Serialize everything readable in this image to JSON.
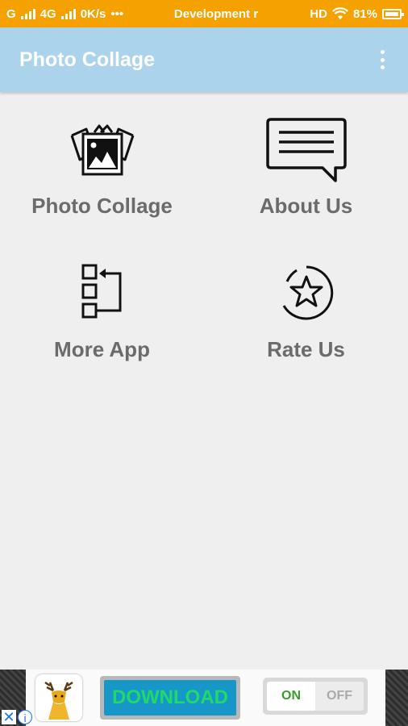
{
  "status_bar": {
    "carrier_signal": "G",
    "network": "4G",
    "speed": "0K/s",
    "more": "•••",
    "notification": "Development r",
    "hd": "HD",
    "battery": "81%"
  },
  "app_bar": {
    "title": "Photo Collage",
    "menu_icon": "overflow-menu-icon"
  },
  "menu": [
    {
      "label": "Photo Collage",
      "icon": "photo-collage-icon"
    },
    {
      "label": "About Us",
      "icon": "chat-bubble-icon"
    },
    {
      "label": "More App",
      "icon": "more-apps-icon"
    },
    {
      "label": "Rate Us",
      "icon": "star-icon"
    }
  ],
  "ad": {
    "download_label": "DOWNLOAD",
    "toggle_on": "ON",
    "toggle_off": "OFF",
    "close_glyph": "✕",
    "info_glyph": "i"
  },
  "colors": {
    "status_bar": "#f5a200",
    "app_bar": "#acd3ec",
    "background": "#efefef",
    "label": "#6b6b6b"
  }
}
